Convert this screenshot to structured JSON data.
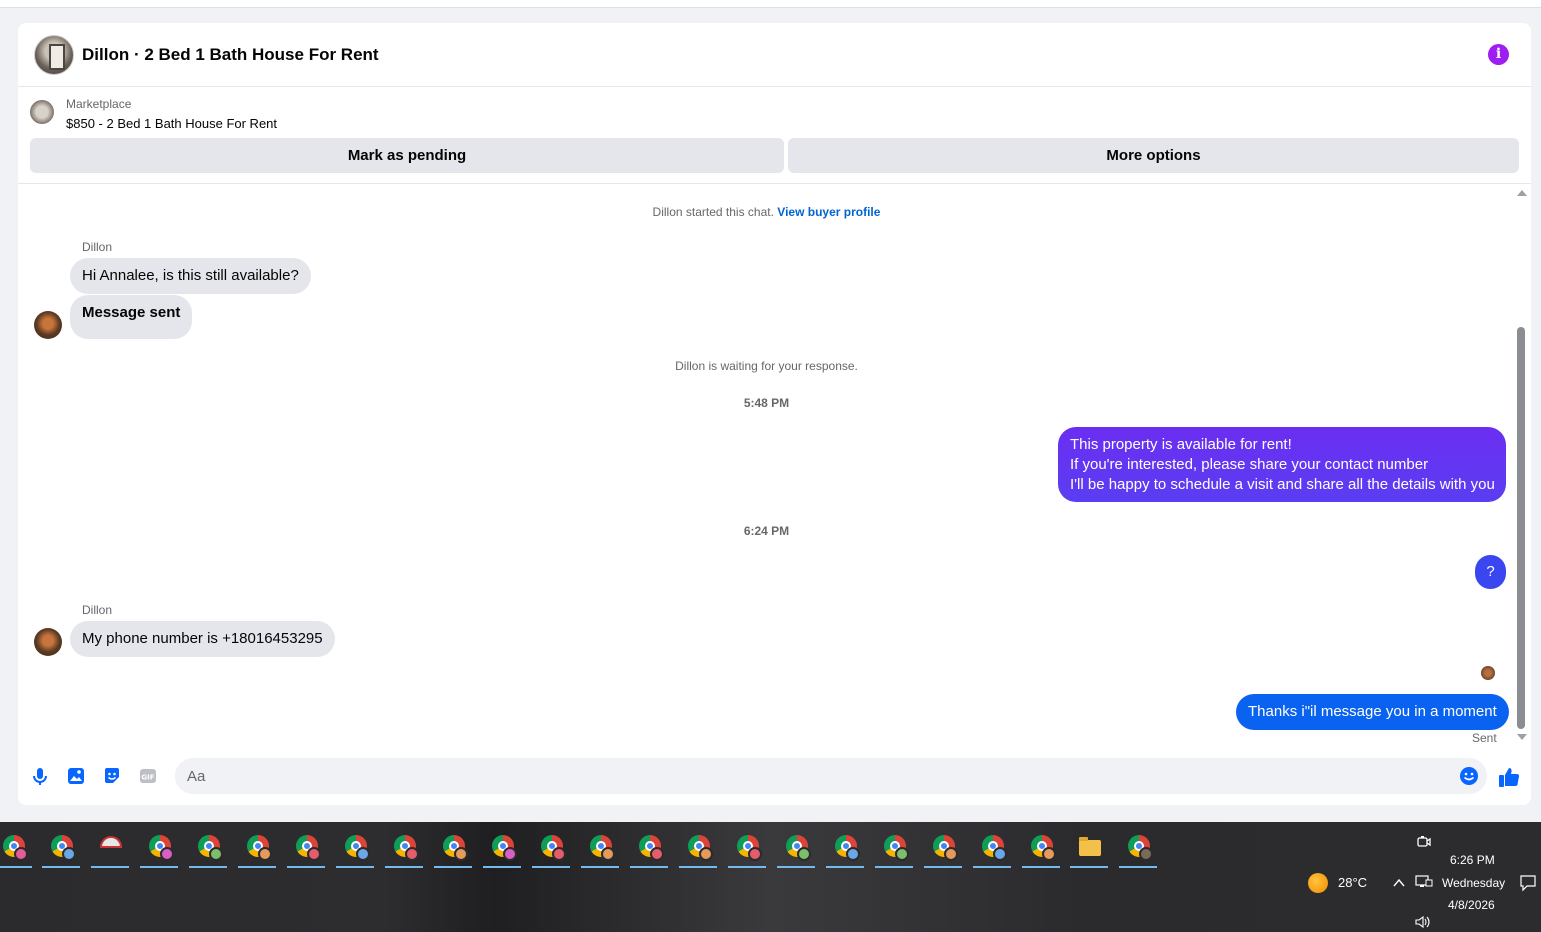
{
  "header": {
    "title": "Dillon · 2 Bed 1 Bath House For Rent"
  },
  "listing": {
    "source": "Marketplace",
    "price_title": "$850 - 2 Bed 1 Bath House For Rent",
    "mark_pending_label": "Mark as pending",
    "more_options_label": "More options"
  },
  "thread": {
    "started_note": "Dillon started this chat.",
    "view_profile_link": "View buyer profile",
    "sender_name_1": "Dillon",
    "msg_in_1": "Hi Annalee, is this still available?",
    "msg_in_2": "Message sent",
    "waiting_note": "Dillon is waiting for your response.",
    "time_1": "5:48 PM",
    "msg_out_1_line1": "This property is available for rent!",
    "msg_out_1_line2": "If you're interested, please share your contact number",
    "msg_out_1_line3": "I'll be happy to schedule a visit and share all the details with you",
    "time_2": "6:24 PM",
    "msg_out_2": "?",
    "sender_name_2": "Dillon",
    "msg_in_3": "My phone number is +18016453295",
    "msg_out_3": "Thanks i\"il message you in a moment",
    "sent_status": "Sent"
  },
  "composer": {
    "placeholder": "Aa",
    "icons": [
      "microphone-icon",
      "photo-icon",
      "sticker-icon",
      "gif-icon",
      "emoji-icon",
      "thumbs-up-icon"
    ]
  },
  "colors": {
    "accent_purple": "#9d1df2",
    "bubble_gradient_top": "#6a2ef0",
    "bubble_blue": "#0866ff",
    "incoming_bubble": "#e4e6eb",
    "link": "#0064d1"
  },
  "taskbar": {
    "weather_temp": "28°C",
    "time": "6:26 PM",
    "day": "Wednesday",
    "date": "4/8/2026"
  }
}
